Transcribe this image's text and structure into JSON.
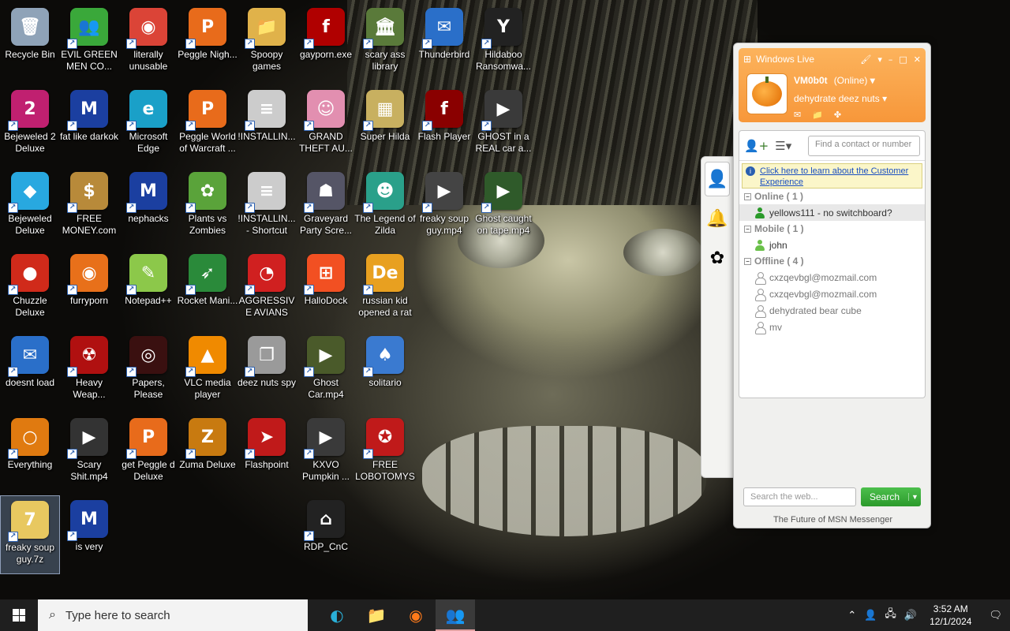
{
  "desktop": {
    "icons": [
      {
        "label": "Recycle Bin",
        "glyph": "🗑",
        "color": "#8fa3b8"
      },
      {
        "label": "EVIL GREEN MEN CO...",
        "glyph": "👥",
        "color": "#3aa83a"
      },
      {
        "label": "literally unusable",
        "glyph": "◉",
        "color": "#db4437"
      },
      {
        "label": "Peggle Nigh...",
        "glyph": "P",
        "color": "#e86b1b"
      },
      {
        "label": "Spoopy games",
        "glyph": "📁",
        "color": "#e0b24a"
      },
      {
        "label": "gayporn.exe",
        "glyph": "f",
        "color": "#b00000"
      },
      {
        "label": "scary ass library",
        "glyph": "🏛",
        "color": "#5a7a3a"
      },
      {
        "label": "Thunderbird",
        "glyph": "✉",
        "color": "#2a6fc9"
      },
      {
        "label": "Hildaboo Ransomwa...",
        "glyph": "Y",
        "color": "#222222"
      },
      {
        "label": "Bejeweled 2 Deluxe",
        "glyph": "2",
        "color": "#c02070"
      },
      {
        "label": "fat like darkok",
        "glyph": "M",
        "color": "#1b3fa0"
      },
      {
        "label": "Microsoft Edge",
        "glyph": "e",
        "color": "#1aa0c8"
      },
      {
        "label": "Peggle World of Warcraft ...",
        "glyph": "P",
        "color": "#e86b1b"
      },
      {
        "label": "!INSTALLIN...",
        "glyph": "≡",
        "color": "#cccccc"
      },
      {
        "label": "GRAND THEFT AU...",
        "glyph": "☺",
        "color": "#e28fb0"
      },
      {
        "label": "Super Hilda",
        "glyph": "▦",
        "color": "#c8b060"
      },
      {
        "label": "Flash Player",
        "glyph": "f",
        "color": "#8a0000"
      },
      {
        "label": "GHOST in a REAL car a...",
        "glyph": "▶",
        "color": "#3a3a3a"
      },
      {
        "label": "Bejeweled Deluxe",
        "glyph": "◆",
        "color": "#28a8e0"
      },
      {
        "label": "FREE MONEY.com",
        "glyph": "$",
        "color": "#b88a3a"
      },
      {
        "label": "nephacks",
        "glyph": "M",
        "color": "#1b3fa0"
      },
      {
        "label": "Plants vs Zombies",
        "glyph": "✿",
        "color": "#5aa33a"
      },
      {
        "label": "!INSTALLIN... - Shortcut",
        "glyph": "≡",
        "color": "#cccccc"
      },
      {
        "label": "Graveyard Party Scre...",
        "glyph": "☗",
        "color": "#555566"
      },
      {
        "label": "The Legend of Zilda",
        "glyph": "☻",
        "color": "#2aa08a"
      },
      {
        "label": "freaky soup guy.mp4",
        "glyph": "▶",
        "color": "#444444"
      },
      {
        "label": "Ghost caught on tape.mp4",
        "glyph": "▶",
        "color": "#2f5a2a"
      },
      {
        "label": "Chuzzle Deluxe",
        "glyph": "●",
        "color": "#d02a1a"
      },
      {
        "label": "furryporn",
        "glyph": "◉",
        "color": "#e8701a"
      },
      {
        "label": "Notepad++",
        "glyph": "✎",
        "color": "#8cc84a"
      },
      {
        "label": "Rocket Mani...",
        "glyph": "➶",
        "color": "#2a8a3a"
      },
      {
        "label": "AGGRESSIVE AVIANS",
        "glyph": "◔",
        "color": "#d02020"
      },
      {
        "label": "HalloDock",
        "glyph": "⊞",
        "color": "#f25022"
      },
      {
        "label": "russian kid opened a rat",
        "glyph": "De",
        "color": "#e8a020"
      },
      {
        "label": "doesnt load",
        "glyph": "✉",
        "color": "#2a6fc9"
      },
      {
        "label": "Heavy Weap...",
        "glyph": "☢",
        "color": "#b01010"
      },
      {
        "label": "Papers, Please",
        "glyph": "◎",
        "color": "#3a1010"
      },
      {
        "label": "VLC media player",
        "glyph": "▲",
        "color": "#f08a00"
      },
      {
        "label": "deez nuts spy",
        "glyph": "❐",
        "color": "#9a9a9a"
      },
      {
        "label": "Ghost Car.mp4",
        "glyph": "▶",
        "color": "#4a5a2a"
      },
      {
        "label": "solitario",
        "glyph": "♠",
        "color": "#3a7ad0"
      },
      {
        "label": "Everything",
        "glyph": "○",
        "color": "#e07a10"
      },
      {
        "label": "Scary Shit.mp4",
        "glyph": "▶",
        "color": "#333333"
      },
      {
        "label": "get Peggle d Deluxe",
        "glyph": "P",
        "color": "#e86b1b"
      },
      {
        "label": "Zuma Deluxe",
        "glyph": "Z",
        "color": "#c87a10"
      },
      {
        "label": "Flashpoint",
        "glyph": "➤",
        "color": "#c01a1a"
      },
      {
        "label": "KXVO Pumpkin ...",
        "glyph": "▶",
        "color": "#3a3a3a"
      },
      {
        "label": "FREE LOBOTOMYS",
        "glyph": "✪",
        "color": "#c01a1a"
      },
      {
        "label": "freaky soup guy.7z",
        "glyph": "7",
        "color": "#e8c860"
      },
      {
        "label": "is very",
        "glyph": "M",
        "color": "#1b3fa0"
      },
      {
        "label": "RDP_CnC",
        "glyph": "⌂",
        "color": "#222222"
      }
    ]
  },
  "msn": {
    "brand": "Windows Live",
    "username": "VM0b0t",
    "status": "(Online)",
    "personal_message": "dehydrate deez nuts",
    "find_placeholder": "Find a contact or number",
    "info_link": "Click here to learn about the Customer Experience",
    "groups": [
      {
        "name": "Online ( 1 )",
        "contacts": [
          {
            "name": "yellows111 - no switchboard?",
            "state": "online"
          }
        ]
      },
      {
        "name": "Mobile ( 1 )",
        "contacts": [
          {
            "name": "john",
            "state": "mobile"
          }
        ]
      },
      {
        "name": "Offline ( 4 )",
        "contacts": [
          {
            "name": "cxzqevbgl@mozmail.com",
            "state": "offline"
          },
          {
            "name": "cxzqevbgl@mozmail.com",
            "state": "offline"
          },
          {
            "name": "dehydrated bear cube",
            "state": "offline"
          },
          {
            "name": "mv",
            "state": "offline"
          }
        ]
      }
    ],
    "search_placeholder": "Search the web...",
    "search_label": "Search",
    "footer": "The Future of MSN Messenger"
  },
  "taskbar": {
    "search_placeholder": "Type here to search",
    "time": "3:52 AM",
    "date": "12/1/2024"
  }
}
